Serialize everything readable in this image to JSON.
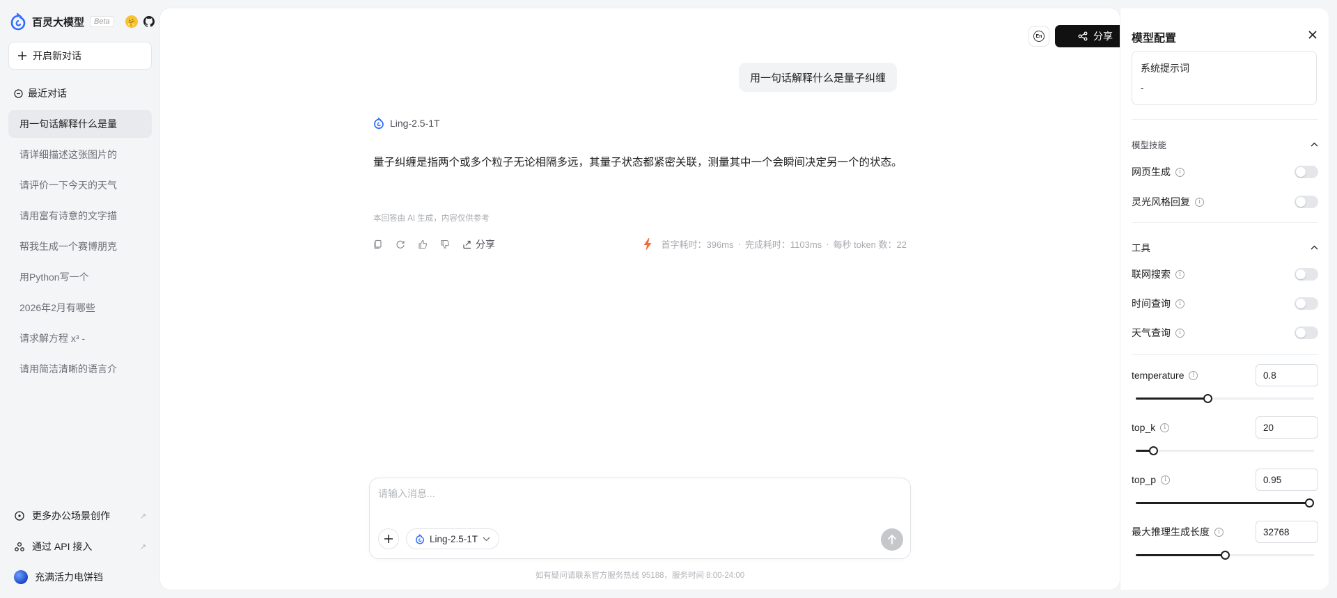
{
  "app": {
    "name": "百灵大模型",
    "beta": "Beta"
  },
  "sidebar": {
    "new_chat": "开启新对话",
    "recent_title": "最近对话",
    "history": [
      {
        "label": "用一句话解释什么是量",
        "active": true
      },
      {
        "label": "请详细描述这张图片的",
        "active": false
      },
      {
        "label": "请评价一下今天的天气",
        "active": false
      },
      {
        "label": "请用富有诗意的文字描",
        "active": false
      },
      {
        "label": "帮我生成一个赛博朋克",
        "active": false
      },
      {
        "label": "用Python写一个",
        "active": false
      },
      {
        "label": "2026年2月有哪些",
        "active": false
      },
      {
        "label": "请求解方程 x³ -",
        "active": false
      },
      {
        "label": "请用简洁清晰的语言介",
        "active": false
      }
    ],
    "bottom": {
      "more_office": "更多办公场景创作",
      "api": "通过 API 接入",
      "user": "充满活力电饼铛"
    }
  },
  "header": {
    "lang_icon": "En",
    "share": "分享"
  },
  "chat": {
    "user_message": "用一句话解释什么是量子纠缠",
    "model_name": "Ling-2.5-1T",
    "answer": "量子纠缠是指两个或多个粒子无论相隔多远，其量子状态都紧密关联，测量其中一个会瞬间决定另一个的状态。",
    "disclaimer": "本回答由 AI 生成，内容仅供参考",
    "share": "分享",
    "stats": {
      "first_token": "首字耗时：396ms",
      "sep1": "·",
      "complete": "完成耗时：1103ms",
      "sep2": "·",
      "tps": "每秒 token 数：22"
    }
  },
  "composer": {
    "placeholder": "请输入消息...",
    "model": "Ling-2.5-1T"
  },
  "footer": "如有疑问请联系官方服务热线 95188，服务时间 8:00-24:00",
  "config": {
    "title": "模型配置",
    "system_prompt_label": "系统提示词",
    "system_prompt_value": "-",
    "skills_title": "模型技能",
    "skills": [
      {
        "label": "网页生成",
        "on": false
      },
      {
        "label": "灵光风格回复",
        "on": false
      }
    ],
    "tools_title": "工具",
    "tools": [
      {
        "label": "联网搜索",
        "on": false
      },
      {
        "label": "时间查询",
        "on": false
      },
      {
        "label": "天气查询",
        "on": false
      }
    ],
    "params": {
      "temperature": {
        "label": "temperature",
        "value": "0.8",
        "fraction": 0.4
      },
      "top_k": {
        "label": "top_k",
        "value": "20",
        "fraction": 0.08
      },
      "top_p": {
        "label": "top_p",
        "value": "0.95",
        "fraction": 1.0
      },
      "max_len": {
        "label": "最大推理生成长度",
        "value": "32768",
        "fraction": 0.5
      }
    }
  },
  "colors": {
    "accent_orange": "#f26b3a",
    "brand_blue": "#2f6bff",
    "share_bg": "#111111"
  }
}
